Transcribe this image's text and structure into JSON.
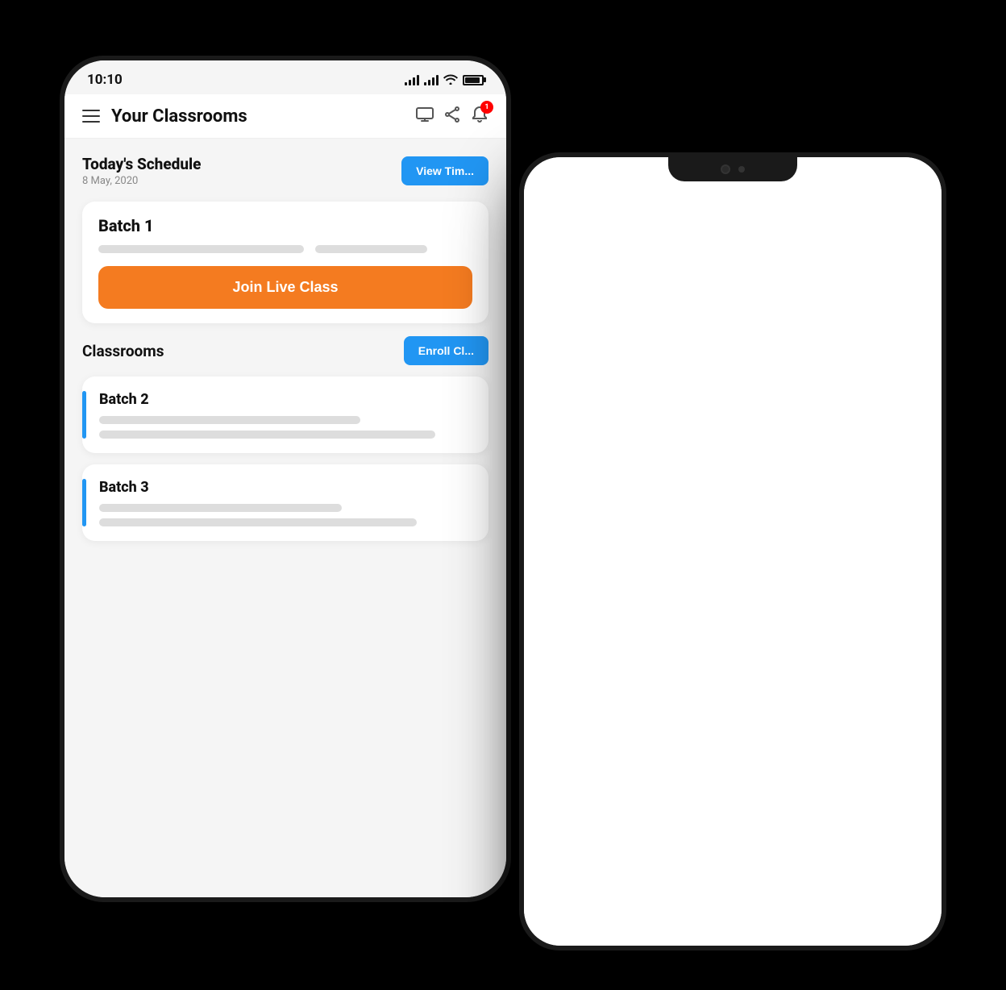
{
  "phone1": {
    "statusBar": {
      "time": "10:10",
      "batteryLevel": "80"
    },
    "header": {
      "title": "Your Classrooms",
      "menuIcon": "☰",
      "monitorIcon": "⬜",
      "shareIcon": "⬡",
      "notificationCount": "1"
    },
    "todaysSchedule": {
      "title": "Today's Schedule",
      "date": "8 May, 2020",
      "viewTimebtnLabel": "View Tim..."
    },
    "batch1Card": {
      "title": "Batch 1",
      "joinLiveClassLabel": "Join Live Class"
    },
    "classrooms": {
      "title": "Classrooms",
      "enrollBtnLabel": "Enroll Cl..."
    },
    "batch2Card": {
      "title": "Batch 2"
    },
    "batch3Card": {
      "title": "Batch 3"
    }
  },
  "phone2": {
    "content": "white"
  },
  "colors": {
    "accent": "#2196F3",
    "orange": "#F47B20",
    "cardBg": "#ffffff",
    "pageBg": "#f5f5f5",
    "titleText": "#111111",
    "subtleText": "#888888",
    "placeholder": "#dddddd"
  }
}
